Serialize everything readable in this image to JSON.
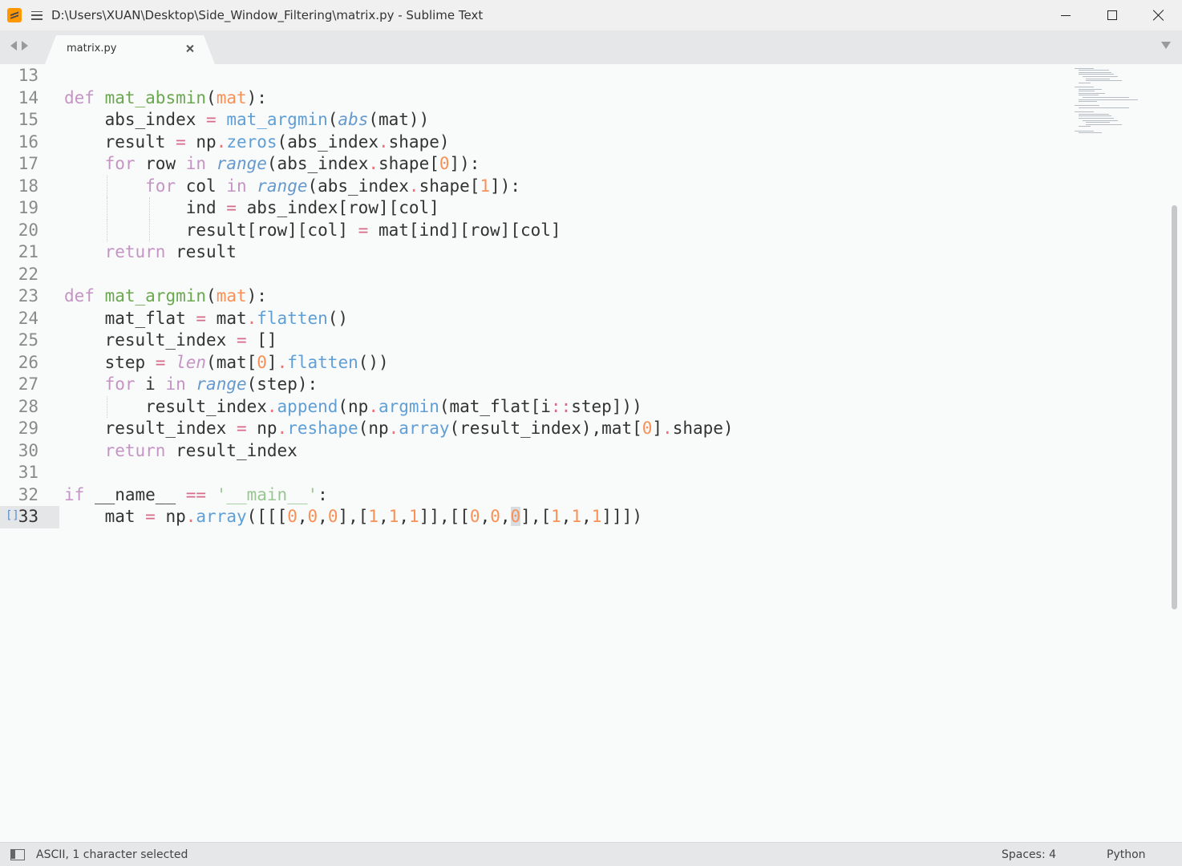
{
  "window": {
    "title": "D:\\Users\\XUAN\\Desktop\\Side_Window_Filtering\\matrix.py - Sublime Text"
  },
  "tabs": [
    {
      "label": "matrix.py",
      "active": true
    }
  ],
  "status": {
    "encoding": "ASCII, 1 character selected",
    "indentation": "Spaces: 4",
    "syntax": "Python"
  },
  "editor": {
    "current_line": 33,
    "lines": [
      {
        "num": "13",
        "text": ""
      },
      {
        "num": "14",
        "text": "def mat_absmin(mat):"
      },
      {
        "num": "15",
        "text": "    abs_index = mat_argmin(abs(mat))"
      },
      {
        "num": "16",
        "text": "    result = np.zeros(abs_index.shape)"
      },
      {
        "num": "17",
        "text": "    for row in range(abs_index.shape[0]):"
      },
      {
        "num": "18",
        "text": "        for col in range(abs_index.shape[1]):"
      },
      {
        "num": "19",
        "text": "            ind = abs_index[row][col]"
      },
      {
        "num": "20",
        "text": "            result[row][col] = mat[ind][row][col]"
      },
      {
        "num": "21",
        "text": "    return result"
      },
      {
        "num": "22",
        "text": ""
      },
      {
        "num": "23",
        "text": "def mat_argmin(mat):"
      },
      {
        "num": "24",
        "text": "    mat_flat = mat.flatten()"
      },
      {
        "num": "25",
        "text": "    result_index = []"
      },
      {
        "num": "26",
        "text": "    step = len(mat[0].flatten())"
      },
      {
        "num": "27",
        "text": "    for i in range(step):"
      },
      {
        "num": "28",
        "text": "        result_index.append(np.argmin(mat_flat[i::step]))"
      },
      {
        "num": "29",
        "text": "    result_index = np.reshape(np.array(result_index),mat[0].shape)"
      },
      {
        "num": "30",
        "text": "    return result_index"
      },
      {
        "num": "31",
        "text": ""
      },
      {
        "num": "32",
        "text": "if __name__ == '__main__':"
      },
      {
        "num": "33",
        "text": "    mat = np.array([[[0,0,0],[1,1,1]],[[0,0,0],[1,1,1]]])"
      }
    ]
  },
  "colors": {
    "keyword": "#c594c5",
    "function_name": "#6aa84f",
    "parameter": "#f99157",
    "operator": "#d66b8a",
    "builtin": "#6699cc",
    "number": "#f99157",
    "method": "#5f9fd6",
    "string": "#99c794",
    "caret": "#5fb3b3"
  },
  "icons": {
    "app": "sublime-text-icon",
    "menu": "hamburger-menu-icon",
    "nav_back": "triangle-left-icon",
    "nav_forward": "triangle-right-icon",
    "tab_close": "close-icon",
    "tab_dropdown": "triangle-down-icon",
    "panel_toggle": "panel-icon"
  }
}
